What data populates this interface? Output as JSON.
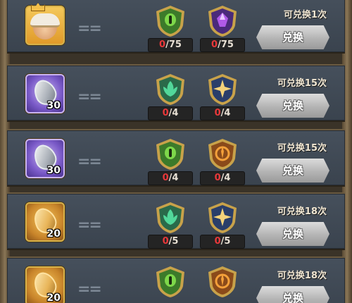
{
  "rows": [
    {
      "item": {
        "kind": "hero",
        "icon": "hero-avatar-icon",
        "count": ""
      },
      "materials": [
        {
          "icon": "green-eye-shield-icon",
          "have": "0",
          "need": "/75",
          "colors": [
            "#3c7a2a",
            "#c8a24a",
            "#7ed84a"
          ]
        },
        {
          "icon": "purple-crystal-shield-icon",
          "have": "0",
          "need": "/75",
          "colors": [
            "#4a2a7a",
            "#c8a24a",
            "#b05ae8"
          ]
        }
      ],
      "limit": "可兑换1次",
      "button": "兑换"
    },
    {
      "item": {
        "kind": "purple",
        "icon": "silver-stone-icon",
        "count": "30"
      },
      "materials": [
        {
          "icon": "green-leaf-shield-icon",
          "have": "0",
          "need": "/4",
          "colors": [
            "#2a6a4a",
            "#c8a24a",
            "#52d89a"
          ]
        },
        {
          "icon": "gold-star-shield-icon",
          "have": "0",
          "need": "/4",
          "colors": [
            "#2a3e6a",
            "#c8a24a",
            "#f4d27a"
          ]
        }
      ],
      "limit": "可兑换15次",
      "button": "兑换"
    },
    {
      "item": {
        "kind": "purple",
        "icon": "silver-stone-icon",
        "count": "30"
      },
      "materials": [
        {
          "icon": "green-eye-shield-icon",
          "have": "0",
          "need": "/4",
          "colors": [
            "#3c7a2a",
            "#c8a24a",
            "#7ed84a"
          ]
        },
        {
          "icon": "fire-emblem-shield-icon",
          "have": "0",
          "need": "/4",
          "colors": [
            "#8a4a1a",
            "#c8a24a",
            "#f4a03a"
          ]
        }
      ],
      "limit": "可兑换15次",
      "button": "兑换"
    },
    {
      "item": {
        "kind": "gold",
        "icon": "gold-stone-icon",
        "count": "20"
      },
      "materials": [
        {
          "icon": "green-leaf-shield-icon",
          "have": "0",
          "need": "/5",
          "colors": [
            "#2a6a4a",
            "#c8a24a",
            "#52d89a"
          ]
        },
        {
          "icon": "gold-star-shield-icon",
          "have": "0",
          "need": "/5",
          "colors": [
            "#2a3e6a",
            "#c8a24a",
            "#f4d27a"
          ]
        }
      ],
      "limit": "可兑换18次",
      "button": "兑换"
    },
    {
      "item": {
        "kind": "gold",
        "icon": "gold-stone-icon",
        "count": "20"
      },
      "materials": [
        {
          "icon": "green-eye-shield-icon",
          "have": "",
          "need": "",
          "colors": [
            "#3c7a2a",
            "#c8a24a",
            "#7ed84a"
          ]
        },
        {
          "icon": "fire-emblem-shield-icon",
          "have": "",
          "need": "",
          "colors": [
            "#8a4a1a",
            "#c8a24a",
            "#f4a03a"
          ]
        }
      ],
      "limit": "可兑换18次",
      "button": "兑换"
    }
  ]
}
